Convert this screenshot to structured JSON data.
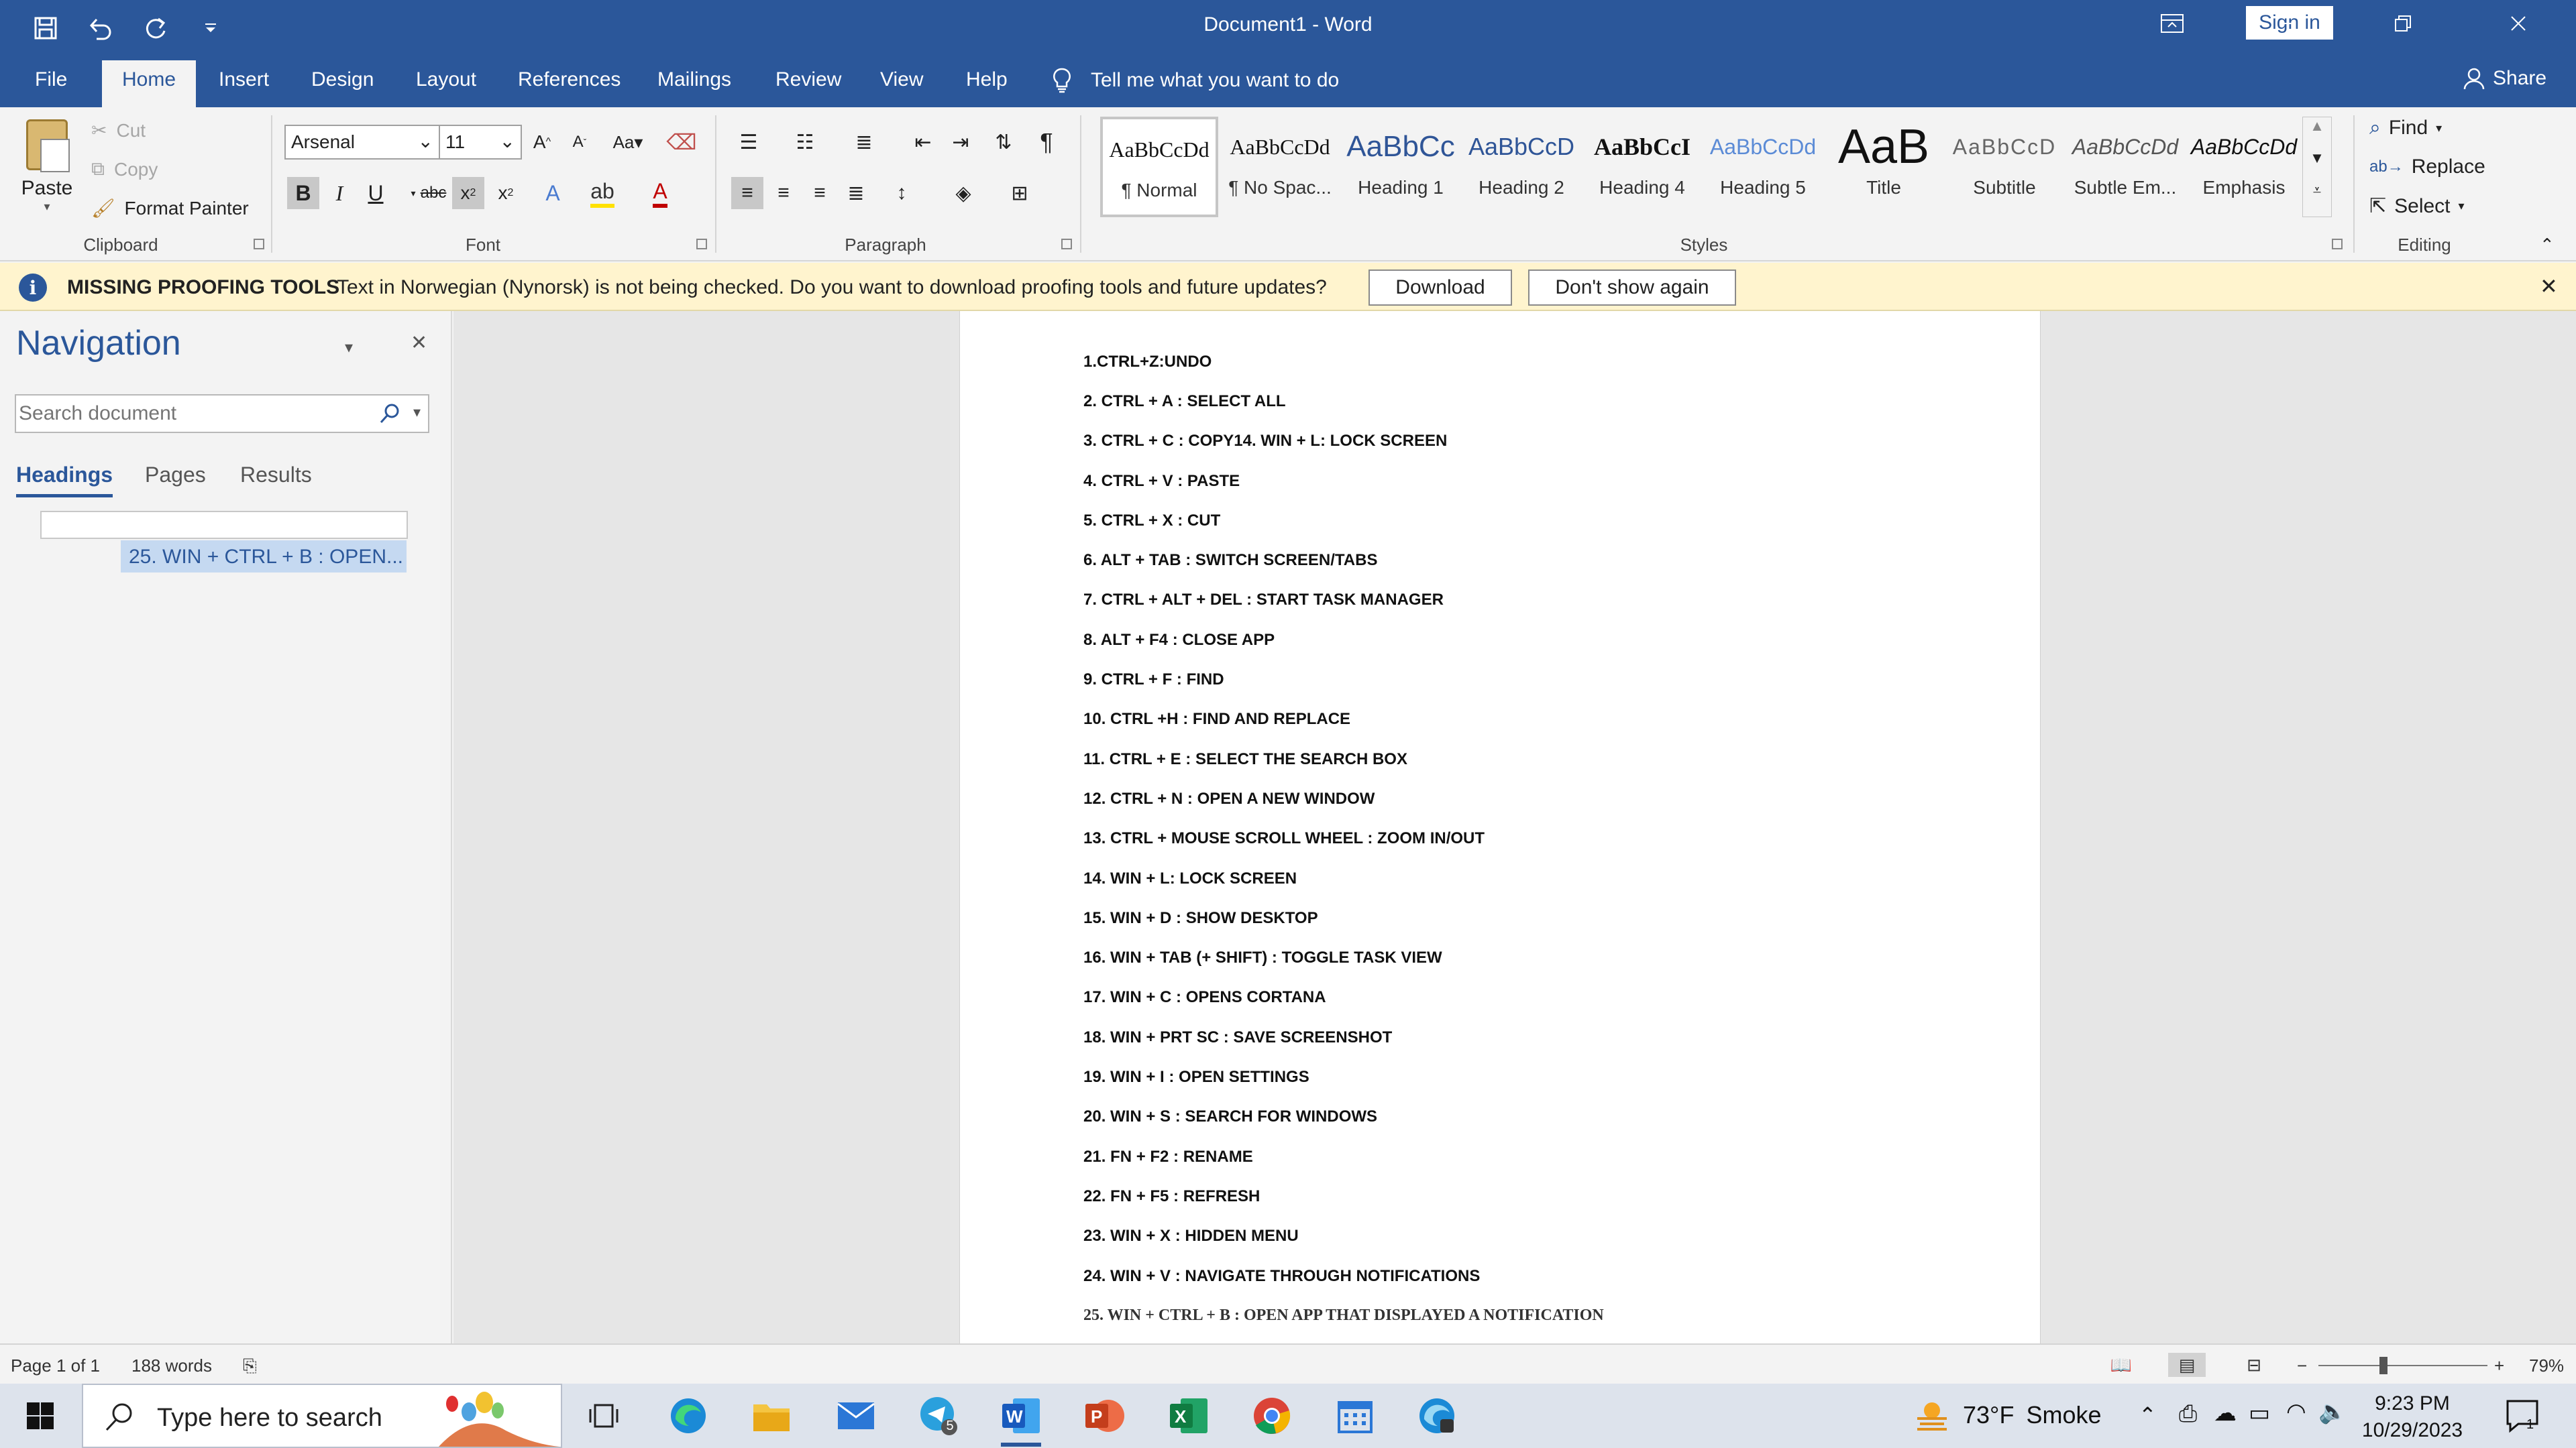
{
  "window": {
    "title": "Document1  -  Word",
    "sign_in": "Sign in"
  },
  "menu": {
    "file": "File",
    "home": "Home",
    "insert": "Insert",
    "design": "Design",
    "layout": "Layout",
    "references": "References",
    "mailings": "Mailings",
    "review": "Review",
    "view": "View",
    "help": "Help",
    "tell_me": "Tell me what you want to do",
    "share": "Share"
  },
  "ribbon": {
    "clipboard": {
      "label": "Clipboard",
      "paste": "Paste",
      "cut": "Cut",
      "copy": "Copy",
      "format_painter": "Format Painter"
    },
    "font": {
      "label": "Font",
      "name": "Arsenal",
      "size": "11",
      "change_case": "Aa"
    },
    "paragraph": {
      "label": "Paragraph"
    },
    "styles": {
      "label": "Styles",
      "items": [
        {
          "preview": "AaBbCcDd",
          "name": "¶ Normal"
        },
        {
          "preview": "AaBbCcDd",
          "name": "¶ No Spac..."
        },
        {
          "preview": "AaBbCc",
          "name": "Heading 1"
        },
        {
          "preview": "AaBbCcD",
          "name": "Heading 2"
        },
        {
          "preview": "AaBbCcI",
          "name": "Heading 4"
        },
        {
          "preview": "AaBbCcDd",
          "name": "Heading 5"
        },
        {
          "preview": "AaB",
          "name": "Title"
        },
        {
          "preview": "AaBbCcD",
          "name": "Subtitle"
        },
        {
          "preview": "AaBbCcDd",
          "name": "Subtle Em..."
        },
        {
          "preview": "AaBbCcDd",
          "name": "Emphasis"
        }
      ]
    },
    "editing": {
      "label": "Editing",
      "find": "Find",
      "replace": "Replace",
      "select": "Select"
    }
  },
  "message_bar": {
    "title": "MISSING PROOFING TOOLS",
    "text": "Text in Norwegian (Nynorsk) is not being checked. Do you want to download proofing tools and future updates?",
    "download": "Download",
    "dont_show": "Don't show again",
    "info_glyph": "i"
  },
  "navigation": {
    "title": "Navigation",
    "search_placeholder": "Search document",
    "tabs": {
      "headings": "Headings",
      "pages": "Pages",
      "results": "Results"
    },
    "headings": [
      "25. WIN + CTRL + B : OPEN..."
    ]
  },
  "document": {
    "lines": [
      "1.CTRL+Z:UNDO",
      "2. CTRL + A : SELECT ALL",
      "3. CTRL + C : COPY14. WIN + L: LOCK SCREEN",
      "4. CTRL + V : PASTE",
      "5. CTRL + X : CUT",
      "6. ALT + TAB : SWITCH SCREEN/TABS",
      "7. CTRL + ALT + DEL : START TASK MANAGER",
      "8. ALT + F4 : CLOSE APP",
      "9. CTRL + F : FIND",
      "10. CTRL +H : FIND AND REPLACE",
      "11. CTRL + E : SELECT THE SEARCH BOX",
      "12. CTRL + N : OPEN A NEW WINDOW",
      "13. CTRL + MOUSE SCROLL WHEEL : ZOOM IN/OUT",
      "14. WIN + L: LOCK SCREEN",
      "15. WIN + D : SHOW DESKTOP",
      "16. WIN + TAB (+ SHIFT) : TOGGLE TASK VIEW",
      "17. WIN + C : OPENS CORTANA",
      "18. WIN + PRT SC : SAVE SCREENSHOT",
      "19. WIN + I : OPEN SETTINGS",
      "20. WIN + S : SEARCH FOR WINDOWS",
      "21. FN + F2 : RENAME",
      "22. FN + F5 : REFRESH",
      "23. WIN + X : HIDDEN MENU",
      "24. WIN + V : NAVIGATE THROUGH NOTIFICATIONS",
      "25. WIN + CTRL + B : OPEN APP THAT DISPLAYED A NOTIFICATION"
    ]
  },
  "status": {
    "page": "Page 1 of 1",
    "words": "188 words",
    "zoom": "79%",
    "zoom_percent": 79
  },
  "taskbar": {
    "search_placeholder": "Type here to search",
    "telegram_badge": "5",
    "weather_temp": "73°F",
    "weather_text": "Smoke",
    "time": "9:23 PM",
    "date": "10/29/2023",
    "notification_count": "1"
  },
  "colors": {
    "accent": "#2b579a",
    "message_bar": "#fff4ce",
    "nav_selected": "#c5d9f1"
  }
}
